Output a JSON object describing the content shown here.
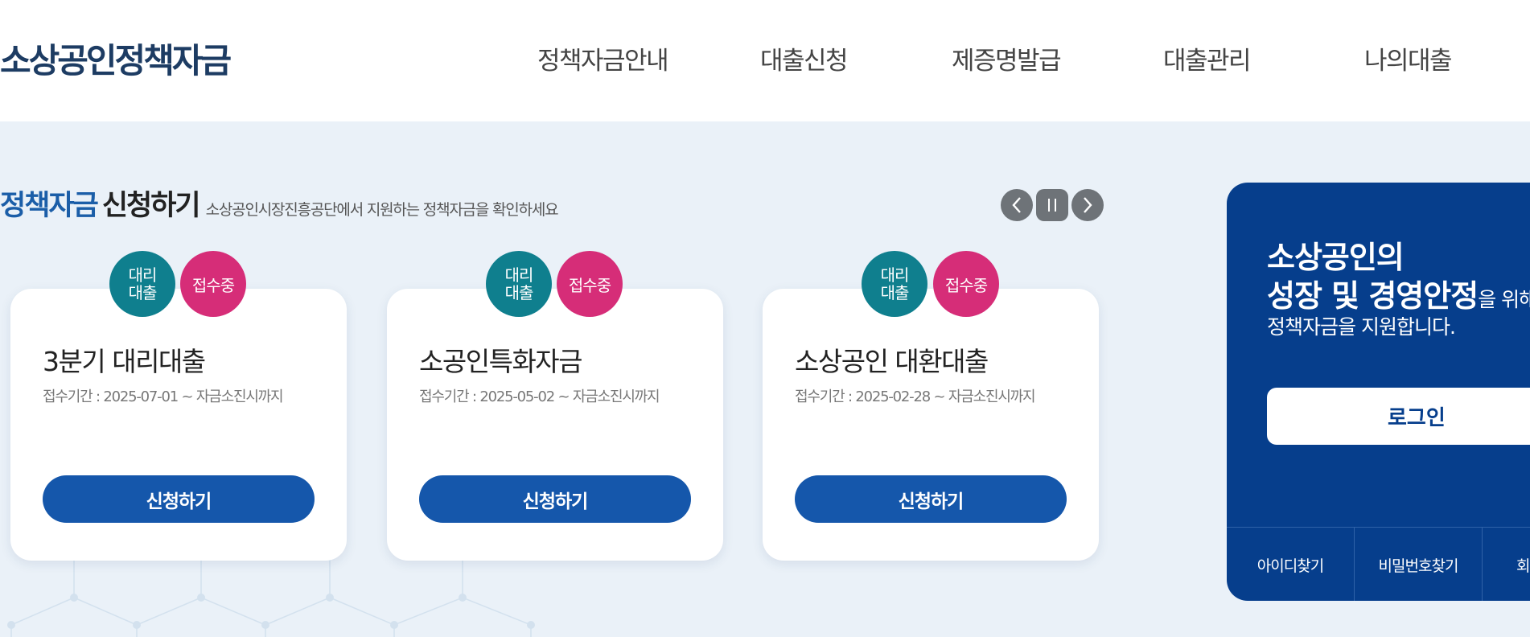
{
  "header": {
    "logo": "소상공인정책자금",
    "nav": [
      "정책자금안내",
      "대출신청",
      "제증명발급",
      "대출관리",
      "나의대출"
    ]
  },
  "section": {
    "title_highlight": "정책자금",
    "title_rest": "신청하기",
    "subtitle": "소상공인시장진흥공단에서 지원하는 정책자금을 확인하세요"
  },
  "slider": {
    "prev_icon": "chevron-left-icon",
    "pause_icon": "pause-icon",
    "next_icon": "chevron-right-icon"
  },
  "cards": [
    {
      "badge_type_line1": "대리",
      "badge_type_line2": "대출",
      "badge_status": "접수중",
      "title": "3분기 대리대출",
      "period": "접수기간 : 2025-07-01 ~ 자금소진시까지",
      "button": "신청하기"
    },
    {
      "badge_type_line1": "대리",
      "badge_type_line2": "대출",
      "badge_status": "접수중",
      "title": "소공인특화자금",
      "period": "접수기간 : 2025-05-02 ~ 자금소진시까지",
      "button": "신청하기"
    },
    {
      "badge_type_line1": "대리",
      "badge_type_line2": "대출",
      "badge_status": "접수중",
      "title": "소상공인 대환대출",
      "period": "접수기간 : 2025-02-28 ~ 자금소진시까지",
      "button": "신청하기"
    }
  ],
  "login_panel": {
    "line1": "소상공인의",
    "line2_strong": "성장 및 경영안정",
    "line2_rest": "을 위해",
    "line3": "정책자금을 지원합니다.",
    "login_button": "로그인",
    "links": [
      "아이디찾기",
      "비밀번호찾기",
      "회원가입"
    ]
  },
  "colors": {
    "brand_navy": "#063e8c",
    "button_blue": "#1557ab",
    "badge_teal": "#0f7f8e",
    "badge_pink": "#d62d78",
    "bg_light": "#eaf1f8"
  }
}
